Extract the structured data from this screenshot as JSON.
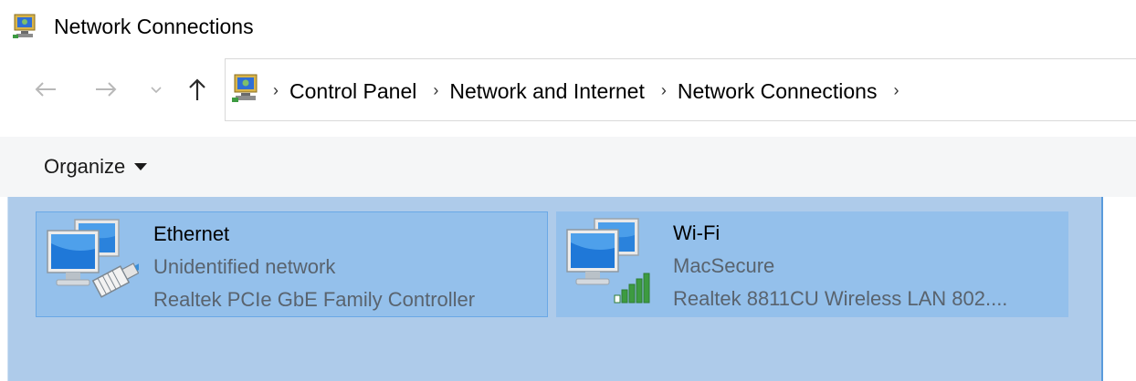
{
  "window": {
    "title": "Network Connections",
    "title_icon": "network-connections-icon"
  },
  "navigation": {
    "back_icon": "arrow-left-icon",
    "forward_icon": "arrow-right-icon",
    "recent_icon": "chevron-down-icon",
    "up_icon": "arrow-up-icon"
  },
  "address_bar": {
    "icon": "control-panel-network-icon",
    "breadcrumbs": [
      {
        "label": "Control Panel"
      },
      {
        "label": "Network and Internet"
      },
      {
        "label": "Network Connections"
      }
    ],
    "separator": "›"
  },
  "command_bar": {
    "organize_label": "Organize"
  },
  "connections": [
    {
      "name": "Ethernet",
      "status": "Unidentified network",
      "device": "Realtek PCIe GbE Family Controller",
      "icon": "ethernet-adapter-icon",
      "selected": true
    },
    {
      "name": "Wi-Fi",
      "status": "MacSecure",
      "device": "Realtek 8811CU Wireless LAN 802....",
      "icon": "wifi-adapter-icon",
      "selected": false
    }
  ],
  "colors": {
    "content_background": "#aecbea",
    "tile_background": "#94c0eb",
    "tile_border": "#6aa8e6",
    "command_bar": "#f5f6f7",
    "signal_green": "#3d9b41"
  }
}
